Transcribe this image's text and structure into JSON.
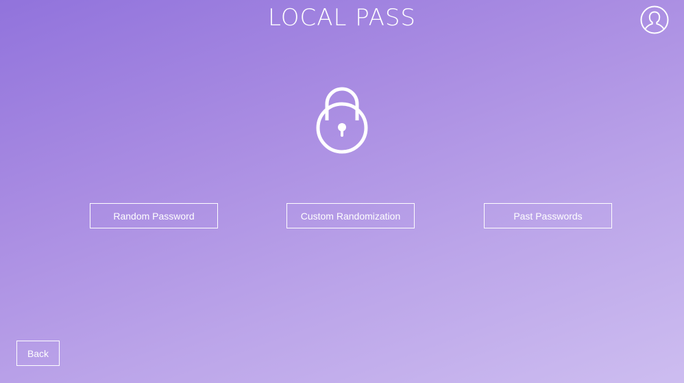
{
  "app": {
    "title": "LOCAL PASS"
  },
  "header": {
    "profile_icon": "user-profile-icon"
  },
  "hero": {
    "icon": "padlock-icon"
  },
  "actions": {
    "random_password_label": "Random Password",
    "custom_randomization_label": "Custom Randomization",
    "past_passwords_label": "Past Passwords"
  },
  "footer": {
    "back_label": "Back"
  },
  "colors": {
    "gradient_start": "#9173dc",
    "gradient_end": "#cdbdf0",
    "foreground": "#ffffff"
  }
}
